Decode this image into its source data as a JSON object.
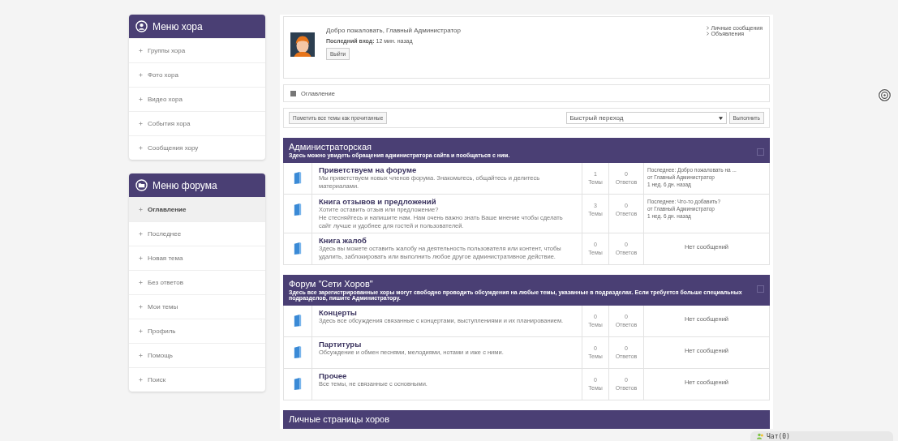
{
  "sidebar": {
    "menus": [
      {
        "title": "Меню хора",
        "items": [
          {
            "label": "Группы хора",
            "selected": false
          },
          {
            "label": "Фото хора",
            "selected": false
          },
          {
            "label": "Видео хора",
            "selected": false
          },
          {
            "label": "События хора",
            "selected": false
          },
          {
            "label": "Сообщения хору",
            "selected": false
          }
        ]
      },
      {
        "title": "Меню форума",
        "items": [
          {
            "label": "Оглавление",
            "selected": true
          },
          {
            "label": "Последнее",
            "selected": false
          },
          {
            "label": "Новая тема",
            "selected": false
          },
          {
            "label": "Без ответов",
            "selected": false
          },
          {
            "label": "Мои темы",
            "selected": false
          },
          {
            "label": "Профиль",
            "selected": false
          },
          {
            "label": "Помощь",
            "selected": false
          },
          {
            "label": "Поиск",
            "selected": false
          }
        ]
      }
    ]
  },
  "user_panel": {
    "welcome": "Добро пожаловать, Главный Администратор",
    "last_visit": "**Последний вход:** 12 мин. назад",
    "logout": "Выйти",
    "links": [
      "Личные сообщения",
      "Объявления"
    ]
  },
  "breadcrumb": "Оглавление",
  "toolbar": {
    "mark_read": "Пометить все темы как прочитанные",
    "quick_jump": "Быстрый переход",
    "go": "Выполнить"
  },
  "categories": [
    {
      "title": "Администраторская",
      "description": "Здесь можно увидеть обращения администратора сайта и пообщаться с ним.",
      "forums": [
        {
          "title": "Приветствуем на форуме",
          "description": "Мы приветствуем новых членов форума. Знакомьтесь, общайтесь и делитесь материалами.",
          "topics": "1",
          "topics_label": "Темы",
          "replies": "0",
          "replies_label": "Ответов",
          "last": [
            "Последнее: Добро пожаловать на ...",
            "от Главный Администратор",
            "1 нед. 6 дн. назад"
          ]
        },
        {
          "title": "Книга отзывов и предложений",
          "description": "Хотите оставить отзыв или предложение?\nНе стесняйтесь и напишите нам. Нам очень важно знать Ваше мнение чтобы сделать сайт лучше и удобнее для гостей и пользователей.",
          "topics": "3",
          "topics_label": "Темы",
          "replies": "0",
          "replies_label": "Ответов",
          "last": [
            "Последнее: Что-то добавить?",
            "от Главный Администратор",
            "1 нед. 6 дн. назад"
          ]
        },
        {
          "title": "Книга жалоб",
          "description": "Здесь вы можете оставить жалобу на деятельность пользователя или контент, чтобы удалить, заблокировать или выполнить любое другое административное действие.",
          "topics": "0",
          "topics_label": "Темы",
          "replies": "0",
          "replies_label": "Ответов",
          "last": [
            "Нет сообщений"
          ]
        }
      ]
    },
    {
      "title": "Форум \"Сети Хоров\"",
      "description": "Здесь все зарегистрированные хоры могут свободно проводить обсуждения на любые темы, указанные в подразделах. Если требуется больше специальных подразделов, пишите Администратору.",
      "forums": [
        {
          "title": "Концерты",
          "description": "Здесь все обсуждения связанные с концертами, выступлениями и их планированием.",
          "topics": "0",
          "topics_label": "Темы",
          "replies": "0",
          "replies_label": "Ответов",
          "last": [
            "Нет сообщений"
          ]
        },
        {
          "title": "Партитуры",
          "description": "Обсуждение и обмен песнями, мелодиями, нотами и иже с ними.",
          "topics": "0",
          "topics_label": "Темы",
          "replies": "0",
          "replies_label": "Ответов",
          "last": [
            "Нет сообщений"
          ]
        },
        {
          "title": "Прочее",
          "description": "Все темы, не связанные с основными.",
          "topics": "0",
          "topics_label": "Темы",
          "replies": "0",
          "replies_label": "Ответов",
          "last": [
            "Нет сообщений"
          ]
        }
      ]
    },
    {
      "title": "Личные страницы хоров"
    }
  ],
  "chat": "Чат(0)"
}
